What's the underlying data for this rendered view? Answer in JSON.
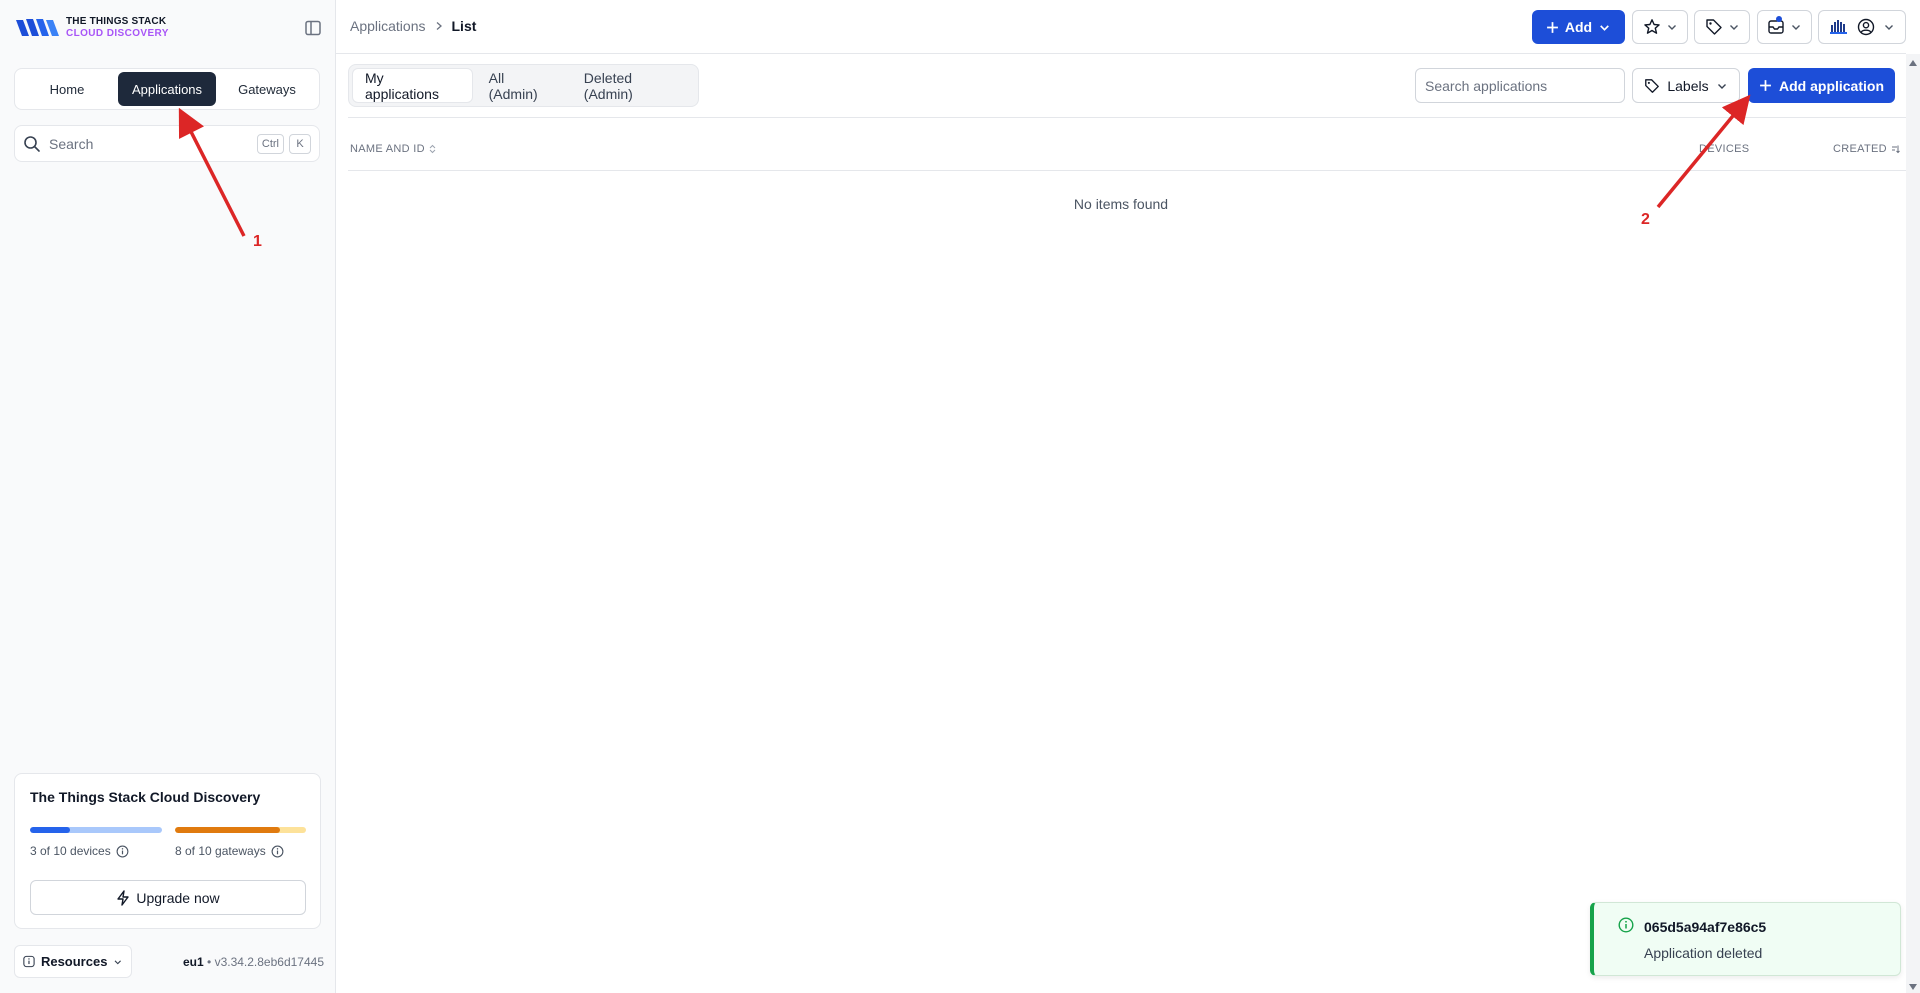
{
  "brand": {
    "line1": "THE THINGS STACK",
    "line2": "CLOUD DISCOVERY",
    "accent": "#a855f7"
  },
  "sidebar": {
    "switcher": [
      {
        "label": "Home",
        "active": false
      },
      {
        "label": "Applications",
        "active": true
      },
      {
        "label": "Gateways",
        "active": false
      }
    ],
    "search": {
      "placeholder": "Search",
      "shortcut_mod": "Ctrl",
      "shortcut_key": "K"
    },
    "plan": {
      "title": "The Things Stack Cloud Discovery",
      "devices": {
        "label": "3 of 10 devices",
        "used": 3,
        "total": 10,
        "color": "#2563eb",
        "track": "#a9c8fb"
      },
      "gateways": {
        "label": "8 of 10 gateways",
        "used": 8,
        "total": 10,
        "color": "#e07a0f",
        "track": "#fde29a"
      },
      "upgrade_label": "Upgrade now"
    },
    "resources_label": "Resources",
    "version": {
      "cluster": "eu1",
      "separator": " • ",
      "build": "v3.34.2.8eb6d17445"
    }
  },
  "header": {
    "breadcrumb": [
      "Applications",
      "List"
    ],
    "add_label": "Add",
    "primary_color": "#1d4ed8"
  },
  "main": {
    "tabs": [
      {
        "label": "My applications",
        "active": true
      },
      {
        "label": "All (Admin)",
        "active": false
      },
      {
        "label": "Deleted (Admin)",
        "active": false
      }
    ],
    "search_placeholder": "Search applications",
    "labels_label": "Labels",
    "add_app_label": "Add application",
    "columns": [
      "NAME AND ID",
      "DEVICES",
      "CREATED"
    ],
    "empty_text": "No items found"
  },
  "toast": {
    "title": "065d5a94af7e86c5",
    "message": "Application deleted",
    "color": "#16a34a"
  },
  "annotations": {
    "color": "#dc2626",
    "labels": [
      "1",
      "2"
    ]
  },
  "icons": [
    "logo-icon",
    "sidebar-toggle-icon",
    "search-icon",
    "info-icon",
    "bolt-icon",
    "plus-icon",
    "chevron-down-icon",
    "star-icon",
    "tag-icon",
    "inbox-icon",
    "org-icon",
    "user-icon",
    "sort-icon"
  ]
}
